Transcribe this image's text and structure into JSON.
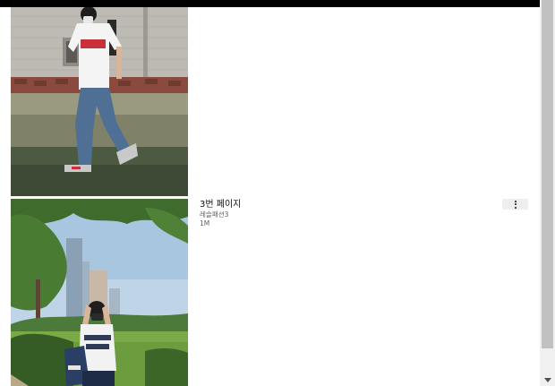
{
  "videos": [
    {
      "thumbnail": "street-fashion-photo-wall"
    },
    {
      "thumbnail": "street-fashion-photo-park",
      "title": "3번 페이지",
      "channel": "레슬패션3",
      "views": "1M",
      "more_icon": "more-vert-icon"
    }
  ],
  "colors": {
    "top_bar": "#000000",
    "scrollbar_track": "#f0f0f0",
    "scrollbar_thumb": "#c1c1c1",
    "title_text": "#0f0f0f",
    "meta_text": "#606060"
  }
}
